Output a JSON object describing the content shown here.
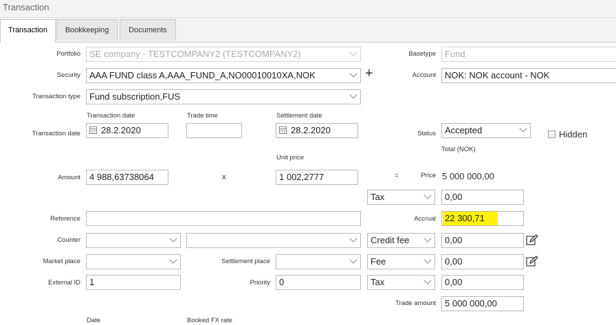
{
  "window": {
    "title": "Transaction"
  },
  "tabs": [
    {
      "label": "Transaction",
      "active": true
    },
    {
      "label": "Bookkeeping",
      "active": false
    },
    {
      "label": "Documents",
      "active": false
    }
  ],
  "form": {
    "portfolio": {
      "label": "Portfolio",
      "value": "SE company - TESTCOMPANY2 (TESTCOMPANY2)"
    },
    "basetype": {
      "label": "Basetype",
      "value": "Fund"
    },
    "security": {
      "label": "Security",
      "value": "AAA FUND class A,AAA_FUND_A,NO00010010XA,NOK",
      "add": "+"
    },
    "account": {
      "label": "Account",
      "value": "NOK: NOK account - NOK"
    },
    "transaction_type": {
      "label": "Transaction type",
      "value": "Fund subscription,FUS"
    },
    "transaction_date": {
      "label": "Transaction date",
      "header": "Transaction date",
      "value": "28.2.2020"
    },
    "trade_time": {
      "header": "Trade time",
      "value": ""
    },
    "settlement_date": {
      "header": "Settlement date",
      "value": "28.2.2020"
    },
    "status": {
      "label": "Status",
      "value": "Accepted"
    },
    "hidden": {
      "label": "Hidden",
      "checked": false
    },
    "total_header": "Total (NOK)",
    "unit_price_header": "Unit price",
    "amount": {
      "label": "Amount",
      "value": "4 988,63738064"
    },
    "multiply": "x",
    "unit_price": {
      "value": "1 002,2777"
    },
    "equals": "=",
    "price": {
      "label": "Price",
      "value": "5 000 000,00"
    },
    "tax1": {
      "select": "Tax",
      "value": "0,00"
    },
    "reference": {
      "label": "Reference",
      "value": ""
    },
    "accrual": {
      "label": "Accrual",
      "value": "22 300,71"
    },
    "counter": {
      "label": "Counter",
      "value": "",
      "value2": ""
    },
    "credit_fee": {
      "select": "Credit fee",
      "value": "0,00"
    },
    "market_place": {
      "label": "Market place",
      "value": ""
    },
    "settlement_place": {
      "label": "Settlement place",
      "value": ""
    },
    "fee": {
      "select": "Fee",
      "value": "0,00"
    },
    "external_id": {
      "label": "External ID",
      "value": "1"
    },
    "priority": {
      "label": "Priority",
      "value": "0"
    },
    "tax2": {
      "select": "Tax",
      "value": "0,00"
    },
    "trade_amount": {
      "label": "Trade amount",
      "value": "5 000 000,00"
    },
    "date_header": "Date",
    "booked_fx_header": "Booked FX rate"
  },
  "colors": {
    "highlight": "#fff200"
  }
}
